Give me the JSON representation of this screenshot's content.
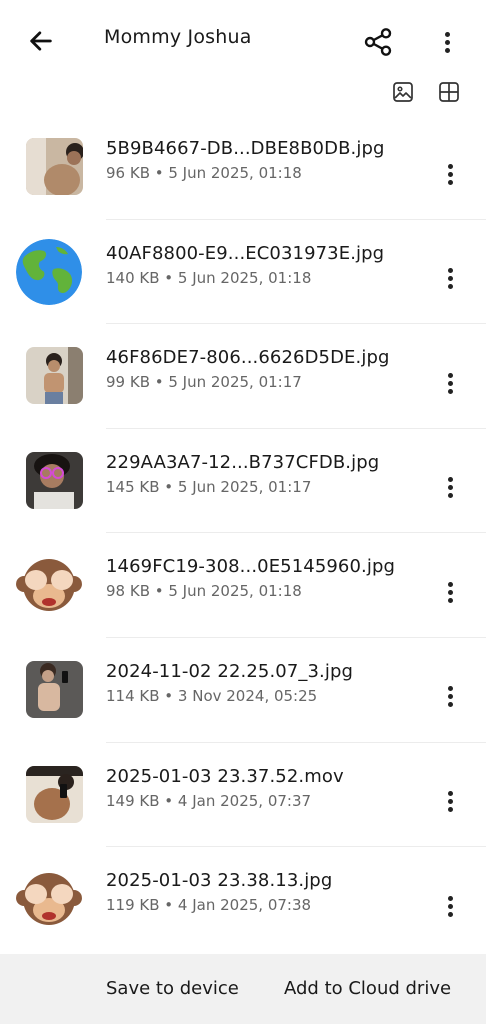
{
  "header": {
    "title": "Mommy Joshua",
    "back_icon": "arrow-left-icon",
    "share_icon": "share-icon",
    "more_icon": "more-vertical-icon"
  },
  "view_options": {
    "image_view_icon": "image-icon",
    "grid_view_icon": "grid-icon"
  },
  "files": [
    {
      "name": "5B9B4667-DB...DBE8B0DB.jpg",
      "meta": "96 KB • 5 Jun 2025, 01:18",
      "thumb": "photo"
    },
    {
      "name": "40AF8800-E9...EC031973E.jpg",
      "meta": "140 KB • 5 Jun 2025, 01:18",
      "thumb": "globe"
    },
    {
      "name": "46F86DE7-806...6626D5DE.jpg",
      "meta": "99 KB • 5 Jun 2025, 01:17",
      "thumb": "photo"
    },
    {
      "name": "229AA3A7-12...B737CFDB.jpg",
      "meta": "145 KB • 5 Jun 2025, 01:17",
      "thumb": "photo"
    },
    {
      "name": "1469FC19-308...0E5145960.jpg",
      "meta": "98 KB • 5 Jun 2025, 01:18",
      "thumb": "monkey"
    },
    {
      "name": "2024-11-02 22.25.07_3.jpg",
      "meta": "114 KB • 3 Nov 2024, 05:25",
      "thumb": "photo"
    },
    {
      "name": "2025-01-03 23.37.52.mov",
      "meta": "149 KB • 4 Jan 2025, 07:37",
      "thumb": "photo"
    },
    {
      "name": "2025-01-03 23.38.13.jpg",
      "meta": "119 KB • 4 Jan 2025, 07:38",
      "thumb": "monkey"
    }
  ],
  "bottom": {
    "save_label": "Save to device",
    "cloud_label": "Add to Cloud drive"
  }
}
